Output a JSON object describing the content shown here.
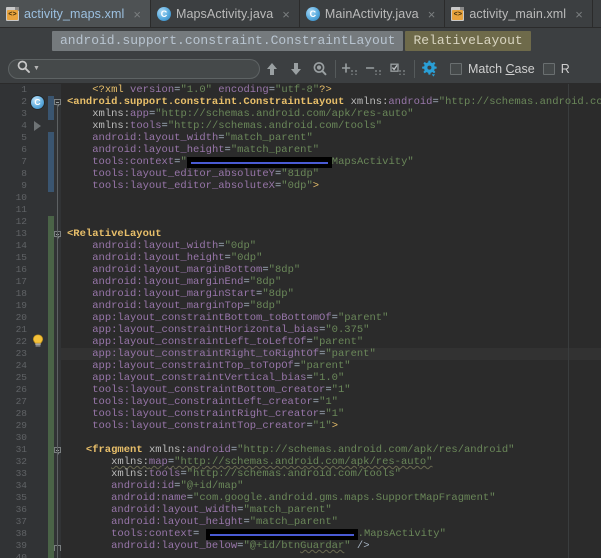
{
  "window": {
    "app": "Android Studio Editor",
    "theme_bg": "#2b2b2b",
    "chrome_bg": "#3c3f41"
  },
  "tabs": [
    {
      "label": "activity_maps.xml",
      "icon": "xml-file-icon",
      "active": true,
      "close": "×"
    },
    {
      "label": "MapsActivity.java",
      "icon": "java-class-icon",
      "active": false,
      "close": "×"
    },
    {
      "label": "MainActivity.java",
      "icon": "java-class-icon",
      "active": false,
      "close": "×"
    },
    {
      "label": "activity_main.xml",
      "icon": "xml-file-icon",
      "active": false,
      "close": "×"
    }
  ],
  "breadcrumb": {
    "items": [
      {
        "label": "android.support.constraint.ConstraintLayout",
        "selected": false
      },
      {
        "label": "RelativeLayout",
        "selected": true
      }
    ]
  },
  "findbar": {
    "search": {
      "value": "",
      "placeholder": "",
      "icon": "search-icon",
      "dropdown_icon": "chevron-down-icon"
    },
    "buttons": [
      {
        "name": "find-previous-button",
        "icon": "arrow-up-icon",
        "label": ""
      },
      {
        "name": "find-next-button",
        "icon": "arrow-down-icon",
        "label": ""
      },
      {
        "name": "select-all-occurrences-button",
        "icon": "magnifier-multi-icon",
        "label": ""
      },
      {
        "name": "add-selection-next-button",
        "icon": "plus-lines-icon",
        "label": ""
      },
      {
        "name": "remove-selection-button",
        "icon": "minus-lines-icon",
        "label": ""
      },
      {
        "name": "select-all-lines-button",
        "icon": "check-lines-icon",
        "label": ""
      },
      {
        "name": "find-settings-button",
        "icon": "gear-icon",
        "label": ""
      }
    ],
    "checkboxes": [
      {
        "name": "match-case-checkbox",
        "label_pre": "Match ",
        "label_underline": "C",
        "label_post": "ase",
        "checked": false
      },
      {
        "name": "regex-checkbox",
        "label_pre": "R",
        "label_underline": "",
        "label_post": "",
        "checked": false
      }
    ]
  },
  "editor": {
    "current_line": 23,
    "first_line": 1,
    "lines": [
      {
        "n": 1,
        "html": "    <span class=\"t-pi\">&lt;?xml</span> <span class=\"t-attr\">version</span><span class=\"t-eq\">=</span><span class=\"t-val\">\"1.0\"</span> <span class=\"t-attr\">encoding</span><span class=\"t-eq\">=</span><span class=\"t-val\">\"utf-8\"</span><span class=\"t-pi\">?&gt;</span>"
      },
      {
        "n": 2,
        "html": "<span class=\"t-tagb\">&lt;android.support.constraint.ConstraintLayout</span> <span class=\"t-ns\">xmlns:</span><span class=\"t-nsv\">android</span><span class=\"t-eq\">=</span><span class=\"t-val\">\"http://schemas.android.com/apk/res/android\"</span>"
      },
      {
        "n": 3,
        "html": "    <span class=\"t-ns\">xmlns:</span><span class=\"t-nsv\">app</span><span class=\"t-eq\">=</span><span class=\"t-val\">\"http://schemas.android.com/apk/res-auto\"</span>"
      },
      {
        "n": 4,
        "html": "    <span class=\"t-ns\">xmlns:</span><span class=\"t-nsv\">tools</span><span class=\"t-eq\">=</span><span class=\"t-val\">\"http://schemas.android.com/tools\"</span>"
      },
      {
        "n": 5,
        "html": "    <span class=\"t-attr\">android:layout_width</span><span class=\"t-eq\">=</span><span class=\"t-val\">\"match_parent\"</span>"
      },
      {
        "n": 6,
        "html": "    <span class=\"t-attr\">android:layout_height</span><span class=\"t-eq\">=</span><span class=\"t-val\">\"match_parent\"</span>"
      },
      {
        "n": 7,
        "html": "    <span class=\"t-attr\">tools:context</span><span class=\"t-eq\">=</span><span class=\"t-val\">\"</span><span class=\"redact\" style=\"width:145px\"></span><span class=\"t-val\">MapsActivity\"</span>"
      },
      {
        "n": 8,
        "html": "    <span class=\"t-attr\">tools:layout_editor_absoluteY</span><span class=\"t-eq\">=</span><span class=\"t-val\">\"81dp\"</span>"
      },
      {
        "n": 9,
        "html": "    <span class=\"t-attr\">tools:layout_editor_absoluteX</span><span class=\"t-eq\">=</span><span class=\"t-val\">\"0dp\"</span><span class=\"t-tag\">&gt;</span>"
      },
      {
        "n": 10,
        "html": ""
      },
      {
        "n": 11,
        "html": ""
      },
      {
        "n": 12,
        "html": ""
      },
      {
        "n": 13,
        "html": "<span class=\"t-tagb\">&lt;RelativeLayout</span>"
      },
      {
        "n": 14,
        "html": "    <span class=\"t-attr\">android:layout_width</span><span class=\"t-eq\">=</span><span class=\"t-val\">\"0dp\"</span>"
      },
      {
        "n": 15,
        "html": "    <span class=\"t-attr\">android:layout_height</span><span class=\"t-eq\">=</span><span class=\"t-val\">\"0dp\"</span>"
      },
      {
        "n": 16,
        "html": "    <span class=\"t-attr\">android:layout_marginBottom</span><span class=\"t-eq\">=</span><span class=\"t-val\">\"8dp\"</span>"
      },
      {
        "n": 17,
        "html": "    <span class=\"t-attr\">android:layout_marginEnd</span><span class=\"t-eq\">=</span><span class=\"t-val\">\"8dp\"</span>"
      },
      {
        "n": 18,
        "html": "    <span class=\"t-attr\">android:layout_marginStart</span><span class=\"t-eq\">=</span><span class=\"t-val\">\"8dp\"</span>"
      },
      {
        "n": 19,
        "html": "    <span class=\"t-attr\">android:layout_marginTop</span><span class=\"t-eq\">=</span><span class=\"t-val\">\"8dp\"</span>"
      },
      {
        "n": 20,
        "html": "    <span class=\"t-attr\">app:layout_constraintBottom_toBottomOf</span><span class=\"t-eq\">=</span><span class=\"t-val\">\"parent\"</span>"
      },
      {
        "n": 21,
        "html": "    <span class=\"t-attr\">app:layout_constraintHorizontal_bias</span><span class=\"t-eq\">=</span><span class=\"t-val\">\"0.375\"</span>"
      },
      {
        "n": 22,
        "html": "    <span class=\"t-attr\">app:layout_constraintLeft_toLeftOf</span><span class=\"t-eq\">=</span><span class=\"t-val\">\"parent\"</span>"
      },
      {
        "n": 23,
        "html": "    <span class=\"t-attr\">app:layout_constraintRight_toRightOf</span><span class=\"t-eq\">=</span><span class=\"t-val\">\"parent\"</span>"
      },
      {
        "n": 24,
        "html": "    <span class=\"t-attr\">app:layout_constraintTop_toTopOf</span><span class=\"t-eq\">=</span><span class=\"t-val\">\"parent\"</span>"
      },
      {
        "n": 25,
        "html": "    <span class=\"t-attr\">app:layout_constraintVertical_bias</span><span class=\"t-eq\">=</span><span class=\"t-val\">\"1.0\"</span>"
      },
      {
        "n": 26,
        "html": "    <span class=\"t-attr\">tools:layout_constraintBottom_creator</span><span class=\"t-eq\">=</span><span class=\"t-val\">\"1\"</span>"
      },
      {
        "n": 27,
        "html": "    <span class=\"t-attr\">tools:layout_constraintLeft_creator</span><span class=\"t-eq\">=</span><span class=\"t-val\">\"1\"</span>"
      },
      {
        "n": 28,
        "html": "    <span class=\"t-attr\">tools:layout_constraintRight_creator</span><span class=\"t-eq\">=</span><span class=\"t-val\">\"1\"</span>"
      },
      {
        "n": 29,
        "html": "    <span class=\"t-attr\">tools:layout_constraintTop_creator</span><span class=\"t-eq\">=</span><span class=\"t-val\">\"1\"</span><span class=\"t-tag\">&gt;</span>"
      },
      {
        "n": 30,
        "html": ""
      },
      {
        "n": 31,
        "html": "   <span class=\"t-tagb\">&lt;fragment</span> <span class=\"t-ns\">xmlns:</span><span class=\"t-nsv\">android</span><span class=\"t-eq\">=</span><span class=\"t-val\">\"http://schemas.android.com/apk/res/android\"</span>"
      },
      {
        "n": 32,
        "html": "       <span class=\"warnsquiggle\"><span class=\"t-ns\">xmlns:</span><span class=\"t-nsv\">map</span><span class=\"t-eq\">=</span><span class=\"t-val\">\"http://schemas.android.com/apk/res-auto\"</span></span>"
      },
      {
        "n": 33,
        "html": "       <span class=\"t-ns\">xmlns:</span><span class=\"t-nsv\">tools</span><span class=\"t-eq\">=</span><span class=\"t-val\">\"http://schemas.android.com/tools\"</span>"
      },
      {
        "n": 34,
        "html": "       <span class=\"t-attr\">android:id</span><span class=\"t-eq\">=</span><span class=\"t-val\">\"@+id/map\"</span>"
      },
      {
        "n": 35,
        "html": "       <span class=\"t-attr\">android:name</span><span class=\"t-eq\">=</span><span class=\"t-val\">\"com.google.android.gms.maps.SupportMapFragment\"</span>"
      },
      {
        "n": 36,
        "html": "       <span class=\"t-attr\">android:layout_width</span><span class=\"t-eq\">=</span><span class=\"t-val\">\"match_parent\"</span>"
      },
      {
        "n": 37,
        "html": "       <span class=\"t-attr\">android:layout_height</span><span class=\"t-eq\">=</span><span class=\"t-val\">\"match_parent\"</span>"
      },
      {
        "n": 38,
        "html": "       <span class=\"t-attr\">tools:context</span><span class=\"t-eq\">=</span> <span class=\"redact\" style=\"width:152px\"></span><span class=\"t-val\">.MapsActivity\"</span>"
      },
      {
        "n": 39,
        "html": "       <span class=\"t-attr\">android:layout_below</span><span class=\"t-eq\">=</span><span class=\"t-val\">\"@+id/btn<span class=\"warnsquiggle\">Guardar</span>\"</span> <span class=\"t-punct\">/&gt;</span>"
      },
      {
        "n": 40,
        "html": ""
      }
    ],
    "gutter": {
      "change_bars": [
        {
          "kind": "blue",
          "from_line": 2,
          "to_line": 3
        },
        {
          "kind": "blue",
          "from_line": 5,
          "to_line": 9
        },
        {
          "kind": "green",
          "from_line": 12,
          "to_line": 40
        }
      ],
      "fold_markers": [
        {
          "line": 2,
          "type": "open"
        },
        {
          "line": 13,
          "type": "open"
        },
        {
          "line": 31,
          "type": "open"
        },
        {
          "line": 39,
          "type": "end"
        }
      ],
      "collapse_arrow_line": 4,
      "bulb_line": 22,
      "class_marker_line": 2,
      "class_marker_glyph": "C"
    }
  }
}
